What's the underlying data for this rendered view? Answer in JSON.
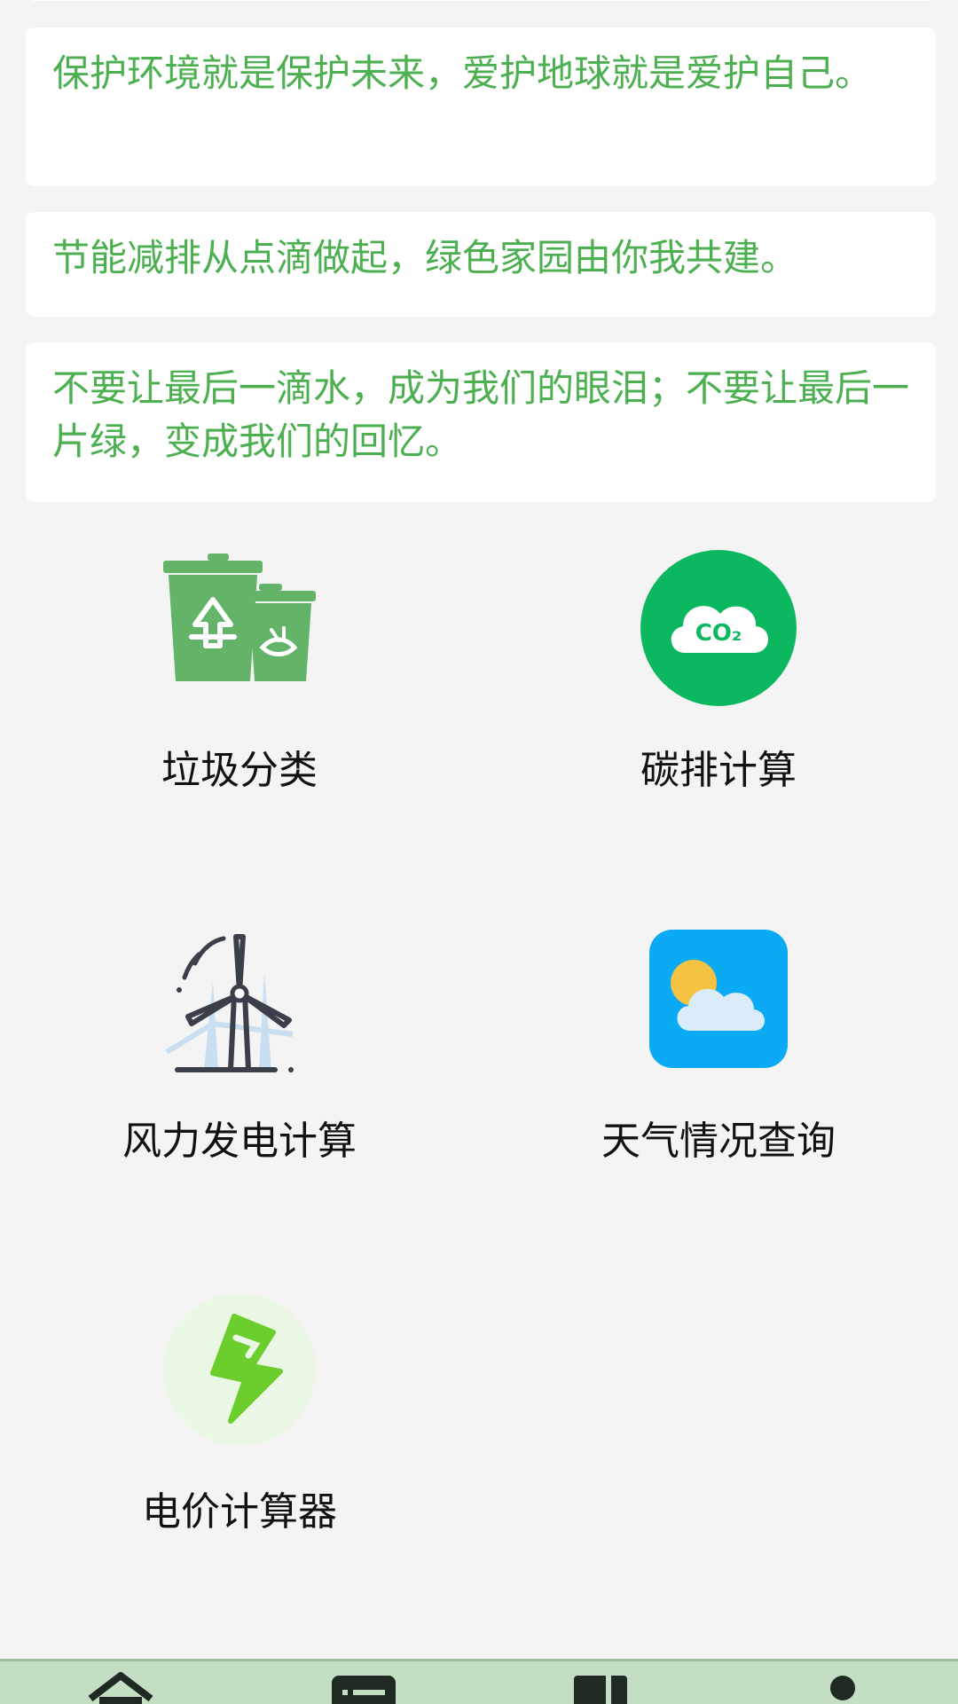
{
  "slogans": [
    "保护环境就是保护未来，爱护地球就是爱护自己。",
    "节能减排从点滴做起，绿色家园由你我共建。",
    "不要让最后一滴水，成为我们的眼泪；不要让最后一片绿，变成我们的回忆。"
  ],
  "features": [
    {
      "label": "垃圾分类",
      "icon": "trash-bins-icon"
    },
    {
      "label": "碳排计算",
      "icon": "co2-cloud-icon"
    },
    {
      "label": "风力发电计算",
      "icon": "wind-turbine-icon"
    },
    {
      "label": "天气情况查询",
      "icon": "weather-icon"
    },
    {
      "label": "电价计算器",
      "icon": "lightning-icon"
    }
  ],
  "co2_text": "CO₂",
  "tabbar": {
    "items": [
      "home-icon",
      "list-icon",
      "book-icon",
      "user-icon"
    ]
  },
  "colors": {
    "slogan_text": "#4caf50",
    "background": "#f4f4f4",
    "tabbar": "#c4dec4",
    "co2_green": "#0cb85f",
    "weather_blue": "#0aaaf5",
    "lightning_green": "#6cce2c"
  }
}
